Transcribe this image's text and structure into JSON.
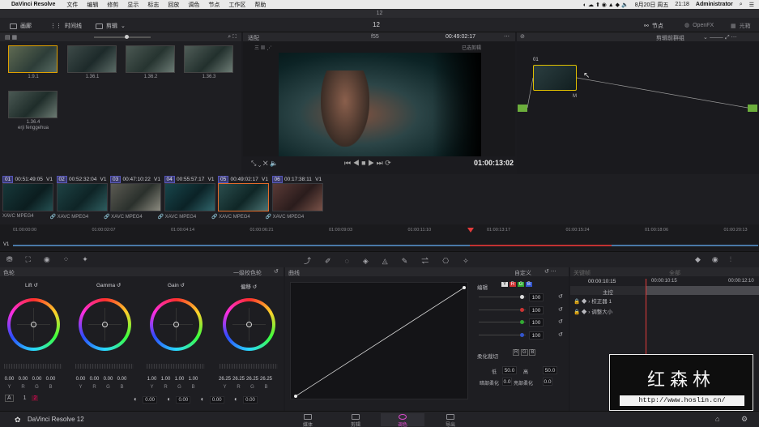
{
  "menubar": {
    "app": "DaVinci Resolve",
    "items": [
      "文件",
      "编辑",
      "修剪",
      "显示",
      "标志",
      "回放",
      "调色",
      "节点",
      "工作区",
      "帮助"
    ],
    "date": "8月20日 周五",
    "time": "21:18",
    "user": "Administrator"
  },
  "window_title": "12",
  "toolbar": {
    "media_pool": "画廊",
    "timeline": "时间线",
    "clips": "剪辑",
    "project": "12",
    "nodes": "节点",
    "openfx": "OpenFX",
    "lightbox": "光箱"
  },
  "gallery": {
    "stills": [
      {
        "label": "1.9.1"
      },
      {
        "label": "1.36.1"
      },
      {
        "label": "1.36.2"
      },
      {
        "label": "1.36.3"
      },
      {
        "label": "1.36.4",
        "sub": "erji fenggehua"
      }
    ]
  },
  "viewer": {
    "fit": "适配",
    "clip_name": "f55",
    "timecode_top": "00:49:02:17",
    "mode": "已选剪辑",
    "timecode": "01:00:13:02"
  },
  "nodes": {
    "mode": "剪辑前群组",
    "node_label": "01"
  },
  "clips": [
    {
      "num": "01",
      "tc": "00:51:49:05",
      "track": "V1",
      "codec": "XAVC MPEG4"
    },
    {
      "num": "02",
      "tc": "00:52:32:04",
      "track": "V1",
      "codec": "XAVC MPEG4"
    },
    {
      "num": "03",
      "tc": "00:47:10:22",
      "track": "V1",
      "codec": "XAVC MPEG4"
    },
    {
      "num": "04",
      "tc": "00:55:57:17",
      "track": "V1",
      "codec": "XAVC MPEG4"
    },
    {
      "num": "05",
      "tc": "00:49:02:17",
      "track": "V1",
      "codec": "XAVC MPEG4"
    },
    {
      "num": "06",
      "tc": "00:17:38:11",
      "track": "V1",
      "codec": "XAVC MPEG4"
    }
  ],
  "ruler": [
    "01:00:00:00",
    "01:00:02:07",
    "01:00:04:14",
    "01:00:06:21",
    "01:00:09:03",
    "01:00:11:10",
    "01:00:13:17",
    "01:00:15:24",
    "01:00:18:06",
    "01:00:20:13"
  ],
  "track_label": "V1",
  "wheels": {
    "title": "色轮",
    "mode": "一级校色轮",
    "items": [
      {
        "name": "Lift",
        "vals": [
          "0.00",
          "0.00",
          "0.00",
          "0.00"
        ]
      },
      {
        "name": "Gamma",
        "vals": [
          "0.00",
          "0.00",
          "0.00",
          "0.00"
        ]
      },
      {
        "name": "Gain",
        "vals": [
          "1.00",
          "1.00",
          "1.00",
          "1.00"
        ]
      },
      {
        "name": "偏移",
        "vals": [
          "26.25",
          "26.25",
          "26.25",
          "26.25"
        ]
      }
    ],
    "channels": [
      "Y",
      "R",
      "G",
      "B"
    ],
    "page_a": "A",
    "page1": "1",
    "page2": "2",
    "adj": [
      "0.00",
      "0.00",
      "0.00",
      "0.00"
    ]
  },
  "curves": {
    "title": "曲线",
    "custom": "自定义",
    "edit": "编辑",
    "channels": [
      "Y",
      "R",
      "G",
      "B"
    ],
    "values": [
      "100",
      "100",
      "100",
      "100"
    ],
    "soft_clip": "柔化裁切",
    "low": "低",
    "low_val": "50.0",
    "high": "高",
    "high_val": "50.0",
    "low_soft": "暗部柔化",
    "low_soft_val": "0.0",
    "high_soft": "亮部柔化",
    "high_soft_val": "0.0"
  },
  "keyframes": {
    "title": "关键帧",
    "all": "全部",
    "tc1": "00:00:10:15",
    "tc2": "00:00:10:15",
    "tc3": "00:00:12:10",
    "master": "主控",
    "rows": [
      "校正器 1",
      "调整大小"
    ]
  },
  "pages": [
    "媒体",
    "剪辑",
    "调色",
    "导出"
  ],
  "footer": {
    "app": "DaVinci Resolve 12"
  },
  "watermark": {
    "cn": "红森林",
    "url": "http://www.hoslin.cn/"
  },
  "colors": {
    "accent": "#e14ad2",
    "playhead": "#e33b3b"
  }
}
